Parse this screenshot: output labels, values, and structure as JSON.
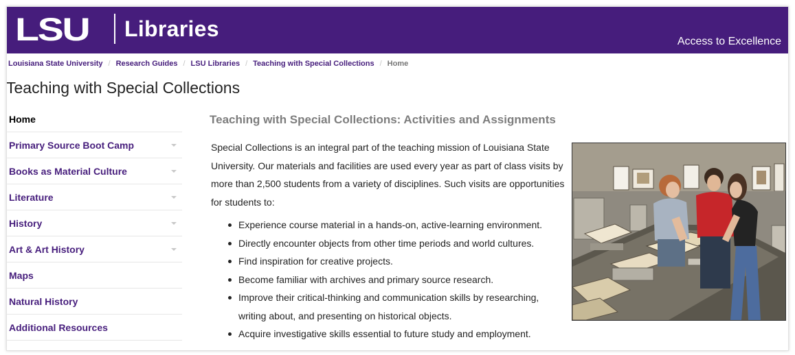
{
  "header": {
    "logo_lsu": "LSU",
    "logo_libraries": "Libraries",
    "tagline": "Access to Excellence",
    "background_color": "#461d7c"
  },
  "breadcrumb": {
    "items": [
      "Louisiana State University",
      "Research Guides",
      "LSU Libraries",
      "Teaching with Special Collections"
    ],
    "current": "Home",
    "separator": "/"
  },
  "page_title": "Teaching with Special Collections",
  "sidenav": {
    "items": [
      {
        "label": "Home",
        "active": true,
        "has_submenu": false
      },
      {
        "label": "Primary Source Boot Camp",
        "active": false,
        "has_submenu": true
      },
      {
        "label": "Books as Material Culture",
        "active": false,
        "has_submenu": true
      },
      {
        "label": "Literature",
        "active": false,
        "has_submenu": true
      },
      {
        "label": "History",
        "active": false,
        "has_submenu": true
      },
      {
        "label": "Art & Art History",
        "active": false,
        "has_submenu": true
      },
      {
        "label": "Maps",
        "active": false,
        "has_submenu": false
      },
      {
        "label": "Natural History",
        "active": false,
        "has_submenu": false
      },
      {
        "label": "Additional Resources",
        "active": false,
        "has_submenu": false
      }
    ],
    "caret_icon": "chevron-down-icon"
  },
  "main": {
    "heading": "Teaching with Special Collections: Activities and Assignments",
    "intro": "Special Collections is an integral part of the teaching mission of Louisiana State University. Our materials and facilities are used every year as part of class visits by more than 2,500 students from a variety of disciplines. Such visits are opportunities for students to:",
    "bullets": [
      "Experience course material in a hands-on, active-learning environment.",
      "Directly encounter objects from other time periods and world cultures.",
      "Find inspiration for creative projects.",
      "Become familiar with archives and primary source research.",
      "Improve their critical-thinking and communication skills by researching, writing about, and presenting on historical objects.",
      "Acquire investigative skills essential to future study and employment."
    ]
  },
  "colors": {
    "accent": "#461d7c",
    "heading_gray": "#7d7d7d",
    "text": "#222222"
  }
}
